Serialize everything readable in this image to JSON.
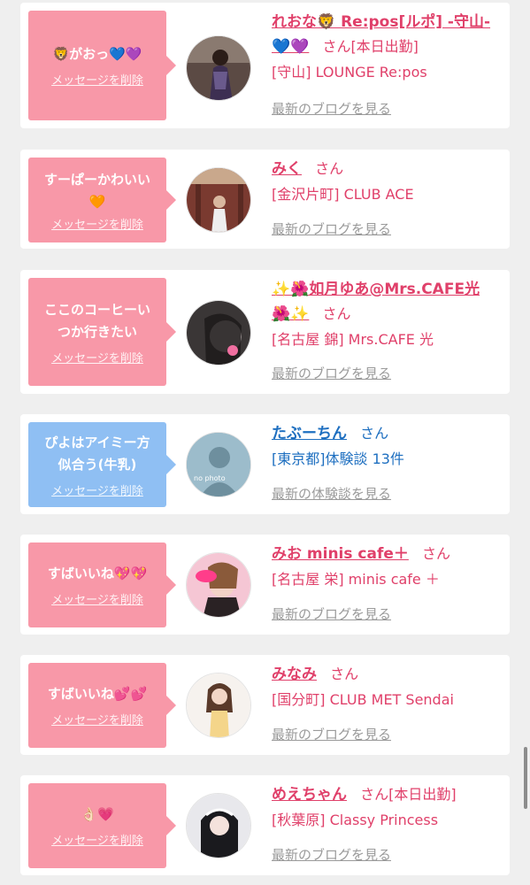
{
  "cards": [
    {
      "message": "🦁がおっ💙💜",
      "delete_label": "メッセージを削除",
      "name": "れおな🦁 Re:pos[ルポ] -守山-💙💜",
      "name_line1": "れおな🦁 Re:pos[ルポ] -守山-",
      "name_line2": "💙💜",
      "san": "さん[本日出勤]",
      "shop": "[守山] LOUNGE Re:pos",
      "blog": "最新のブログを見る",
      "color": "#e0406a"
    },
    {
      "message_line1": "すーぱーかわいい",
      "message_line2": "🧡",
      "delete_label": "メッセージを削除",
      "name": "みく",
      "san": "さん",
      "shop": "[金沢片町] CLUB ACE",
      "blog": "最新のブログを見る",
      "color": "#e0406a"
    },
    {
      "message_line1": "ここのコーヒーい",
      "message_line2": "つか行きたい",
      "delete_label": "メッセージを削除",
      "name_line1": "✨🌺如月ゆあ@Mrs.CAFE光",
      "name_line2": "🌺✨",
      "san": "さん",
      "shop": "[名古屋 錦] Mrs.CAFE 光",
      "blog": "最新のブログを見る",
      "color": "#e0406a"
    },
    {
      "message_line1": "ぴよはアイミー方",
      "message_line2": "似合う(牛乳)",
      "delete_label": "メッセージを削除",
      "name": "たぶーちん",
      "san": "さん",
      "shop": "[東京都]体験談 13件",
      "blog": "最新の体験談を見る",
      "avatar_text": "no photo",
      "color": "#1e6fc0"
    },
    {
      "message": "すばいいね💖💖",
      "delete_label": "メッセージを削除",
      "name": "みお minis cafe＋",
      "san": "さん",
      "shop": "[名古屋 栄] minis cafe ＋",
      "blog": "最新のブログを見る",
      "color": "#e0406a"
    },
    {
      "message": "すばいいね💕💕",
      "delete_label": "メッセージを削除",
      "name": "みなみ",
      "san": "さん",
      "shop": "[国分町] CLUB MET Sendai",
      "blog": "最新のブログを見る",
      "color": "#e0406a"
    },
    {
      "message": "👌🏻💗",
      "delete_label": "メッセージを削除",
      "name": "めえちゃん",
      "san": "さん[本日出勤]",
      "shop": "[秋葉原] Classy Princess",
      "blog": "最新のブログを見る",
      "color": "#e0406a"
    }
  ]
}
